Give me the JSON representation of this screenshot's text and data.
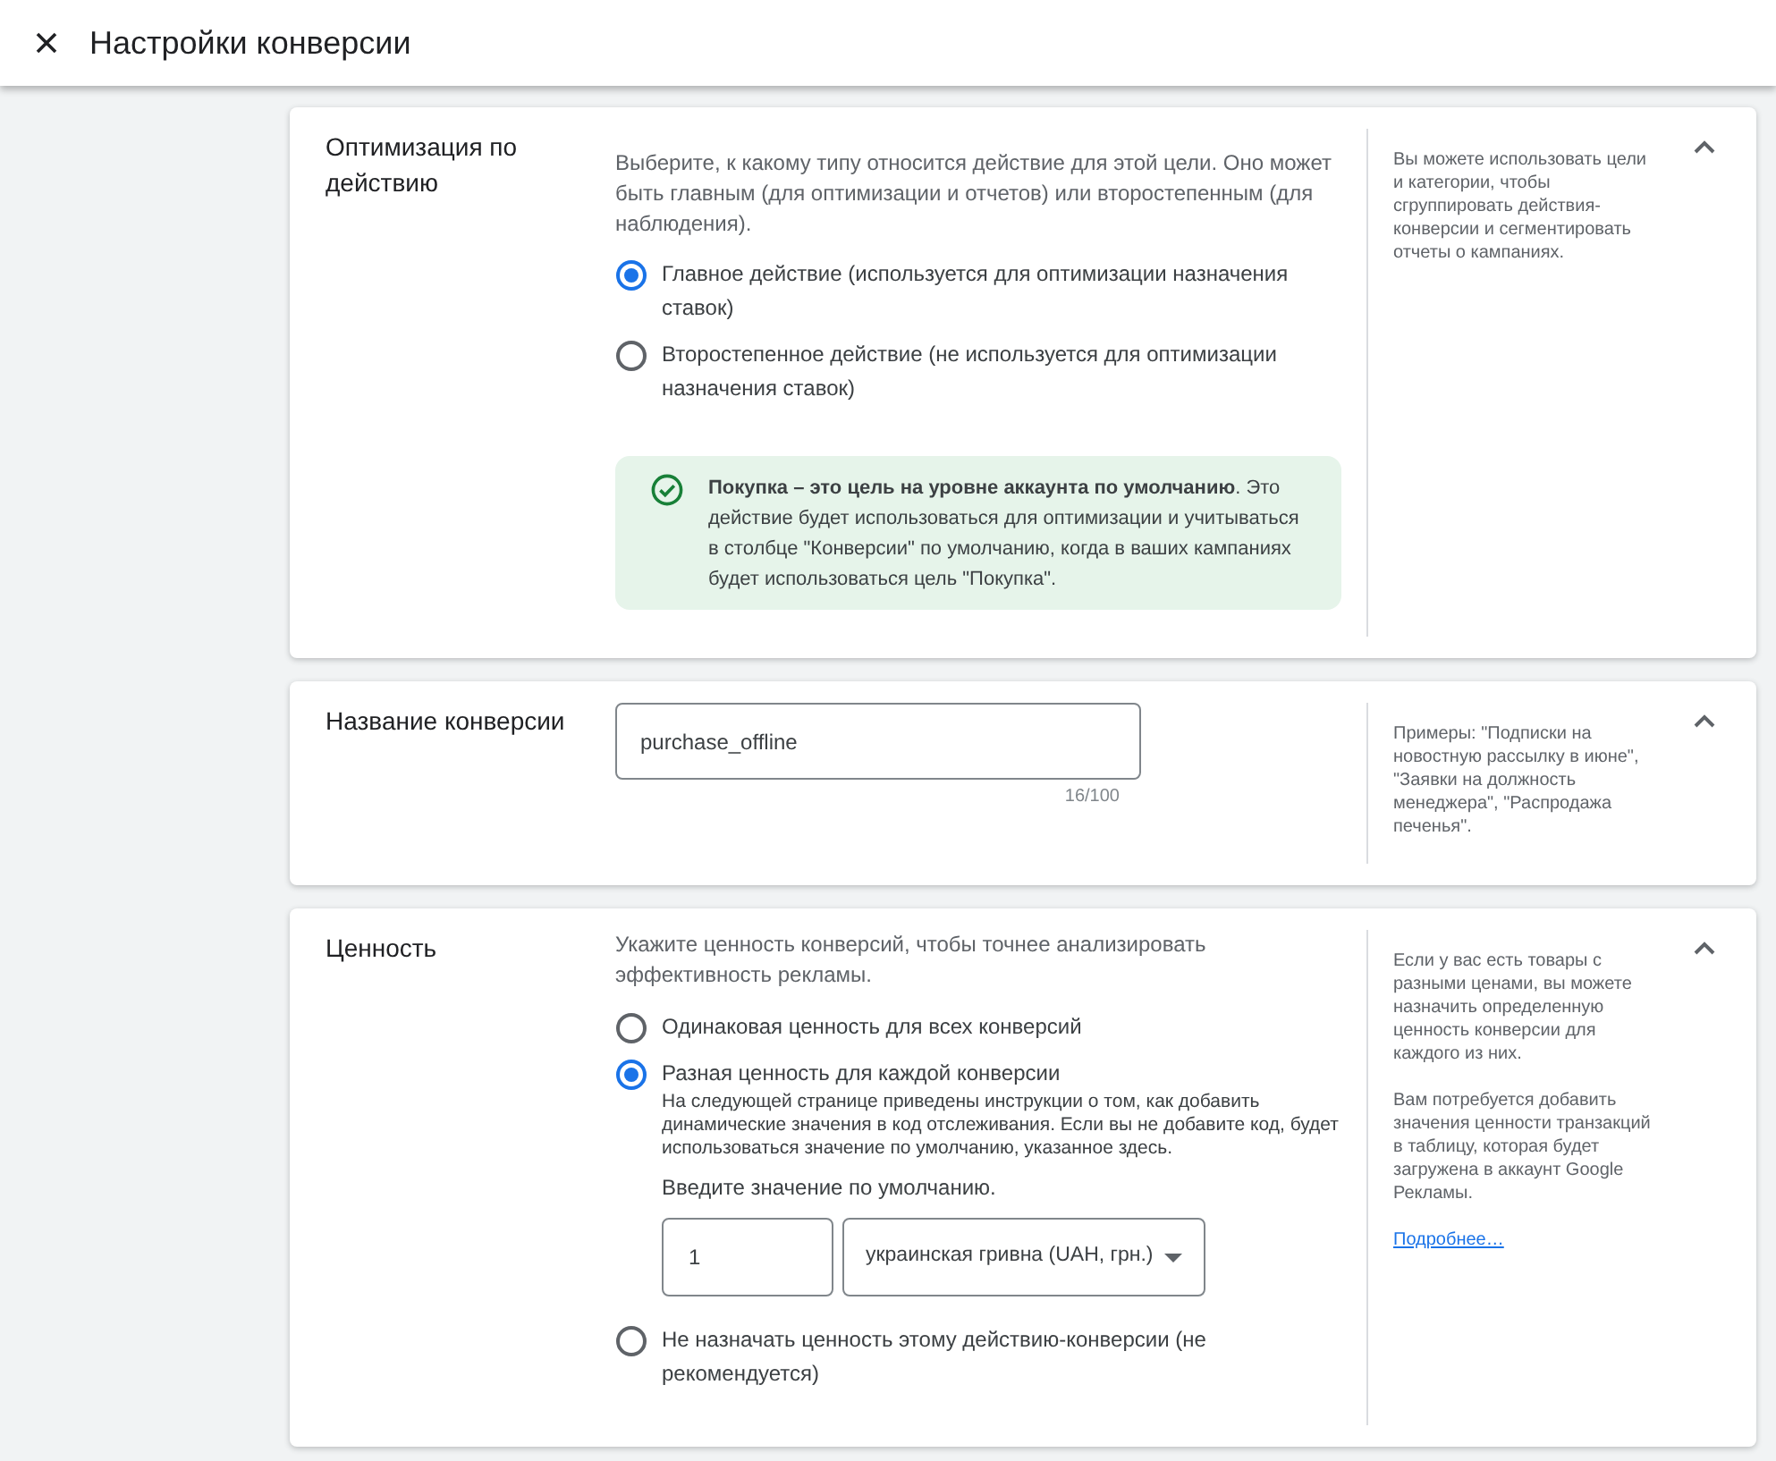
{
  "header": {
    "title": "Настройки конверсии"
  },
  "sections": [
    {
      "kind": "action_type",
      "title": "Оптимизация по действию",
      "expanded": true,
      "description": "Выберите, к какому типу относится действие для этой цели. Оно может быть главным (для оптимизации и отчетов) или второстепенным (для наблюдения).",
      "options": [
        {
          "label": "Главное действие (используется для оптимизации назначения ставок)",
          "selected": true
        },
        {
          "label": "Второстепенное действие (не используется для оптимизации назначения ставок)",
          "selected": false
        }
      ],
      "notice": {
        "text": "**Покупка – это цель на уровне аккаунта по умолчанию**. Это действие будет использоваться для оптимизации и учитываться в столбце \"Конверсии\" по умолчанию, когда в ваших кампаниях будет использоваться цель \"Покупка\"."
      },
      "help": {
        "paragraphs": [
          "Вы можете использовать цели и категории, чтобы сгруппировать действия-конверсии и сегментировать отчеты о кампаниях."
        ]
      }
    },
    {
      "kind": "name",
      "title": "Название конверсии",
      "expanded": true,
      "field": {
        "value": "purchase_offline",
        "counter": "16/100"
      },
      "help": {
        "paragraphs": [
          "Примеры: \"Подписки на новостную рассылку в июне\", \"Заявки на должность менеджера\", \"Распродажа печенья\"."
        ]
      }
    },
    {
      "kind": "value",
      "title": "Ценность",
      "expanded": true,
      "description": "Укажите ценность конверсий, чтобы точнее анализировать эффективность рекламы.",
      "options": [
        {
          "label": "Одинаковая ценность для всех конверсий",
          "selected": false
        },
        {
          "label": "Разная ценность для каждой конверсии",
          "selected": true,
          "hint": "На следующей странице приведены инструкции о том, как добавить динамические значения в код отслеживания. Если вы не добавите код, будет использоваться значение по умолчанию, указанное здесь.",
          "default_value": {
            "prompt": "Введите значение по умолчанию.",
            "amount": "1",
            "currency": "украинская гривна (UAH, грн.)"
          }
        },
        {
          "label": "Не назначать ценность этому действию-конверсии (не рекомендуется)",
          "selected": false
        }
      ],
      "help": {
        "paragraphs": [
          "Если у вас есть товары с разными ценами, вы можете назначить определенную ценность конверсии для каждого из них.",
          "Вам потребуется добавить значения ценности транзакций в таблицу, которая будет загружена в аккаунт Google Рекламы."
        ],
        "link": "Подробнее…"
      }
    }
  ]
}
